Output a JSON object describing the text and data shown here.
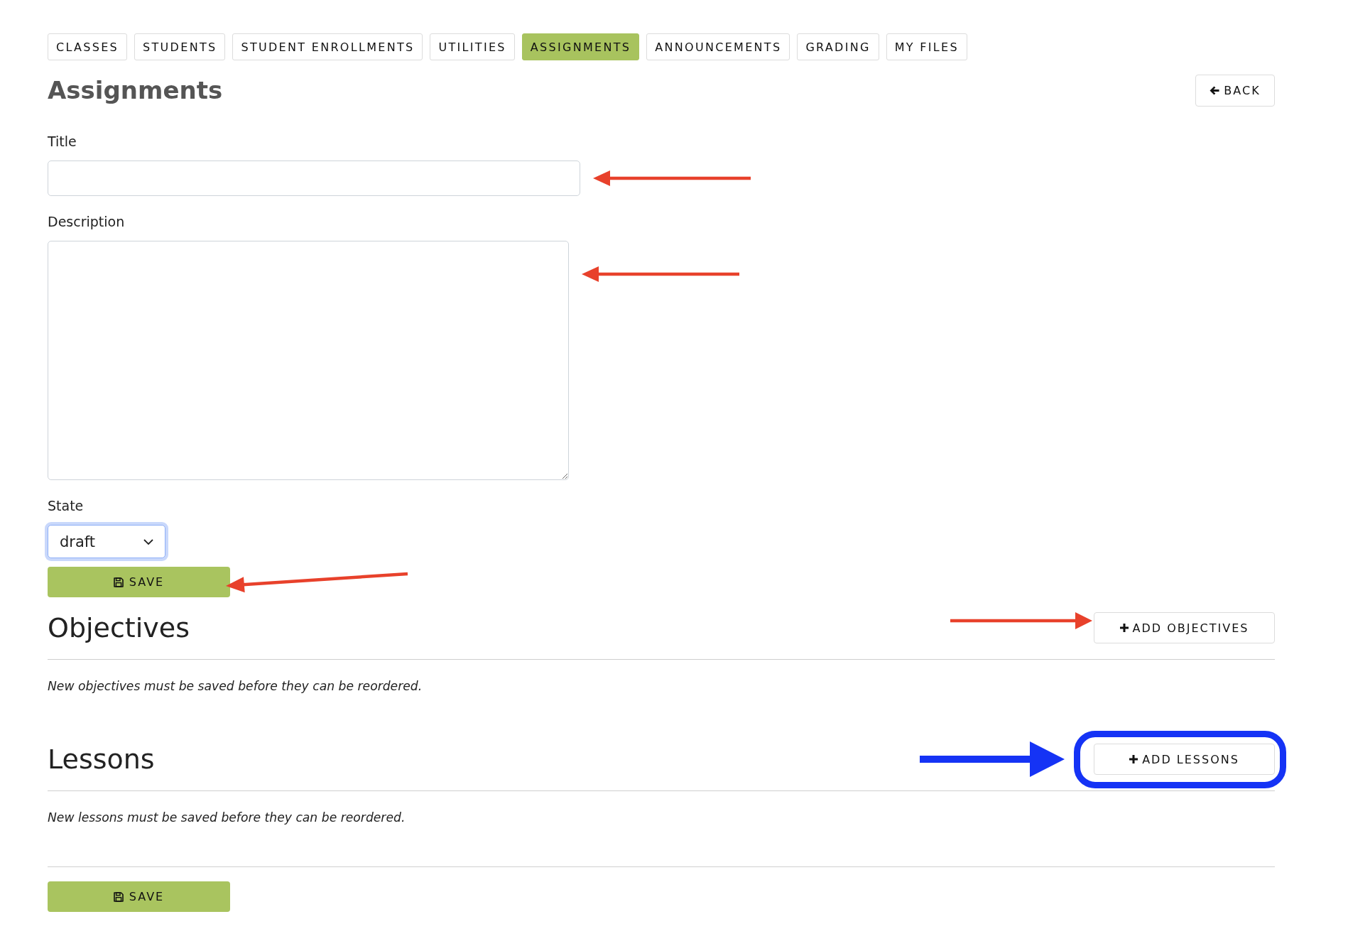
{
  "nav_tabs": [
    {
      "label": "CLASSES",
      "selected": false
    },
    {
      "label": "STUDENTS",
      "selected": false
    },
    {
      "label": "STUDENT ENROLLMENTS",
      "selected": false
    },
    {
      "label": "UTILITIES",
      "selected": false
    },
    {
      "label": "ASSIGNMENTS",
      "selected": true
    },
    {
      "label": "ANNOUNCEMENTS",
      "selected": false
    },
    {
      "label": "GRADING",
      "selected": false
    },
    {
      "label": "MY FILES",
      "selected": false
    }
  ],
  "page_title": "Assignments",
  "back_button": {
    "label": "BACK"
  },
  "form": {
    "fields": [
      {
        "kind": "text",
        "label": "Title",
        "marked": true
      },
      {
        "kind": "textarea",
        "label": "Description",
        "marked": true
      },
      {
        "kind": "select",
        "label": "State",
        "value": "draft",
        "focused": true,
        "marked": false
      }
    ],
    "save_button": {
      "label": "SAVE",
      "marked": true
    }
  },
  "sections": [
    {
      "title": "Objectives",
      "add_button": {
        "label": "ADD OBJECTIVES",
        "marked": true,
        "highlighted": false
      },
      "note": "New objectives must be saved before they can be reordered."
    },
    {
      "title": "Lessons",
      "add_button": {
        "label": "ADD LESSONS",
        "marked": true,
        "highlighted": true
      },
      "note": "New lessons must be saved before they can be reordered."
    }
  ],
  "footer_save_button": {
    "label": "SAVE",
    "marked": false
  }
}
